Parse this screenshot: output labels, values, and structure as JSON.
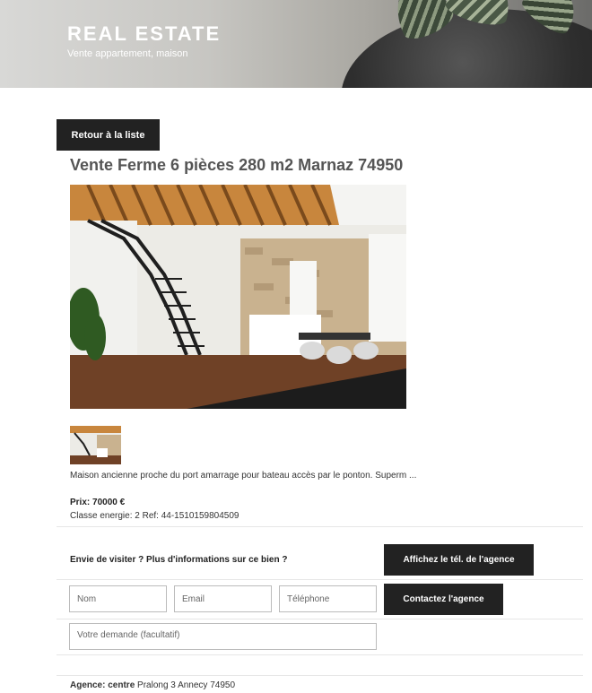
{
  "header": {
    "site_title": "REAL ESTATE",
    "tagline": "Vente appartement, maison"
  },
  "nav": {
    "back_label": "Retour à la liste"
  },
  "listing": {
    "title": "Vente Ferme 6 pièces 280 m2 Marnaz 74950",
    "description": "Maison ancienne proche du port amarrage pour bateau accès par le ponton. Superm ...",
    "price_label": "Prix:",
    "price_value": "70000 €",
    "energy_ref": "Classe energie: 2 Ref: 44-1510159804509"
  },
  "contact": {
    "question": "Envie de visiter ? Plus d'informations sur ce bien ?",
    "phone_button": "Affichez le tél. de l'agence",
    "contact_button": "Contactez l'agence",
    "name_placeholder": "Nom",
    "email_placeholder": "Email",
    "phone_placeholder": "Téléphone",
    "message_placeholder": "Votre demande (facultatif)"
  },
  "agency": {
    "label": "Agence:",
    "name": "centre",
    "address": "Pralong 3 Annecy 74950"
  },
  "colors": {
    "button_bg": "#222222",
    "button_text": "#ffffff",
    "title_text": "#555555"
  }
}
